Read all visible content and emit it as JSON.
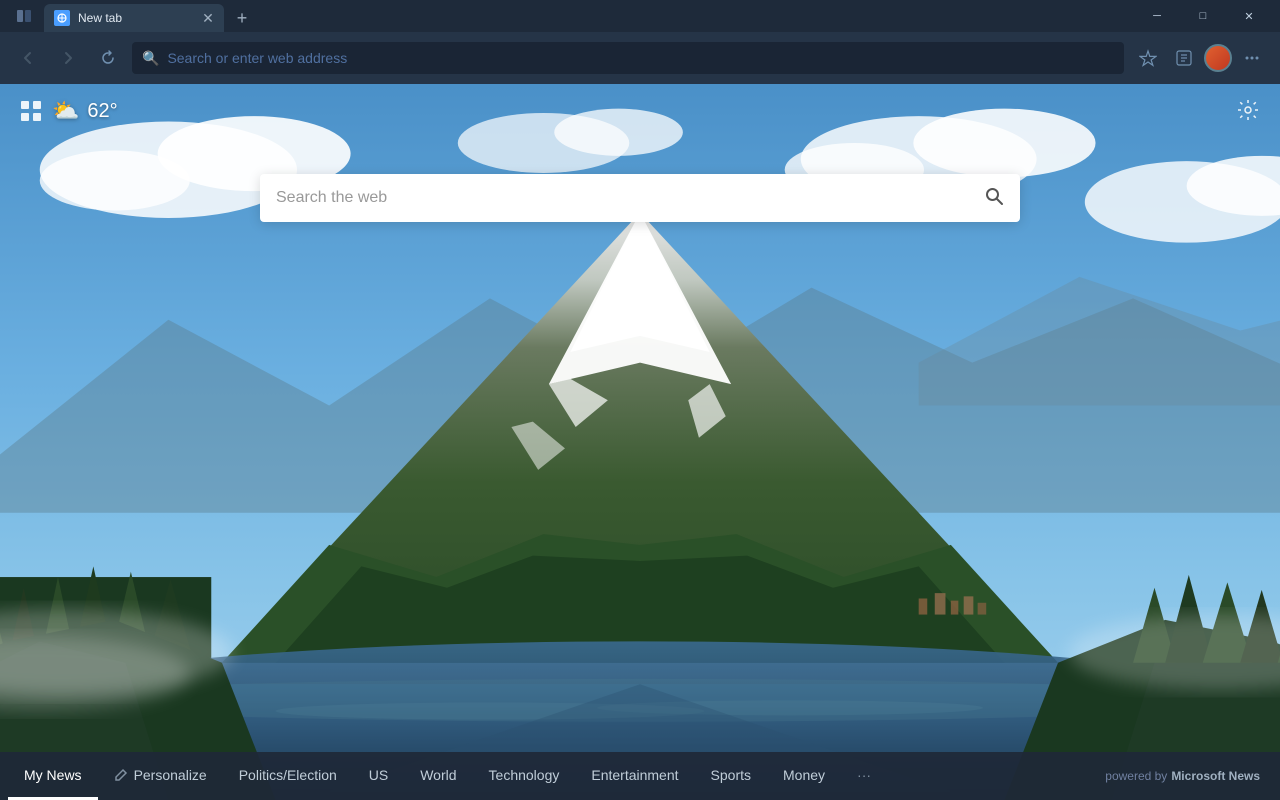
{
  "browser": {
    "tab": {
      "title": "New tab",
      "favicon": "🌐"
    },
    "new_tab_btn": "+",
    "controls": {
      "minimize": "─",
      "maximize": "□",
      "close": "✕"
    },
    "address_bar": {
      "placeholder": "Search or enter web address"
    }
  },
  "weather": {
    "icon": "⛅",
    "temperature": "62°"
  },
  "search": {
    "placeholder": "Search the web"
  },
  "news_tabs": [
    {
      "id": "my-news",
      "label": "My News",
      "active": true
    },
    {
      "id": "personalize",
      "label": "Personalize",
      "has_icon": true
    },
    {
      "id": "politics",
      "label": "Politics/Election"
    },
    {
      "id": "us",
      "label": "US"
    },
    {
      "id": "world",
      "label": "World"
    },
    {
      "id": "technology",
      "label": "Technology"
    },
    {
      "id": "entertainment",
      "label": "Entertainment"
    },
    {
      "id": "sports",
      "label": "Sports"
    },
    {
      "id": "money",
      "label": "Money"
    },
    {
      "id": "more",
      "label": "···"
    }
  ],
  "powered_by": {
    "prefix": "powered by",
    "brand": "Microsoft News"
  }
}
